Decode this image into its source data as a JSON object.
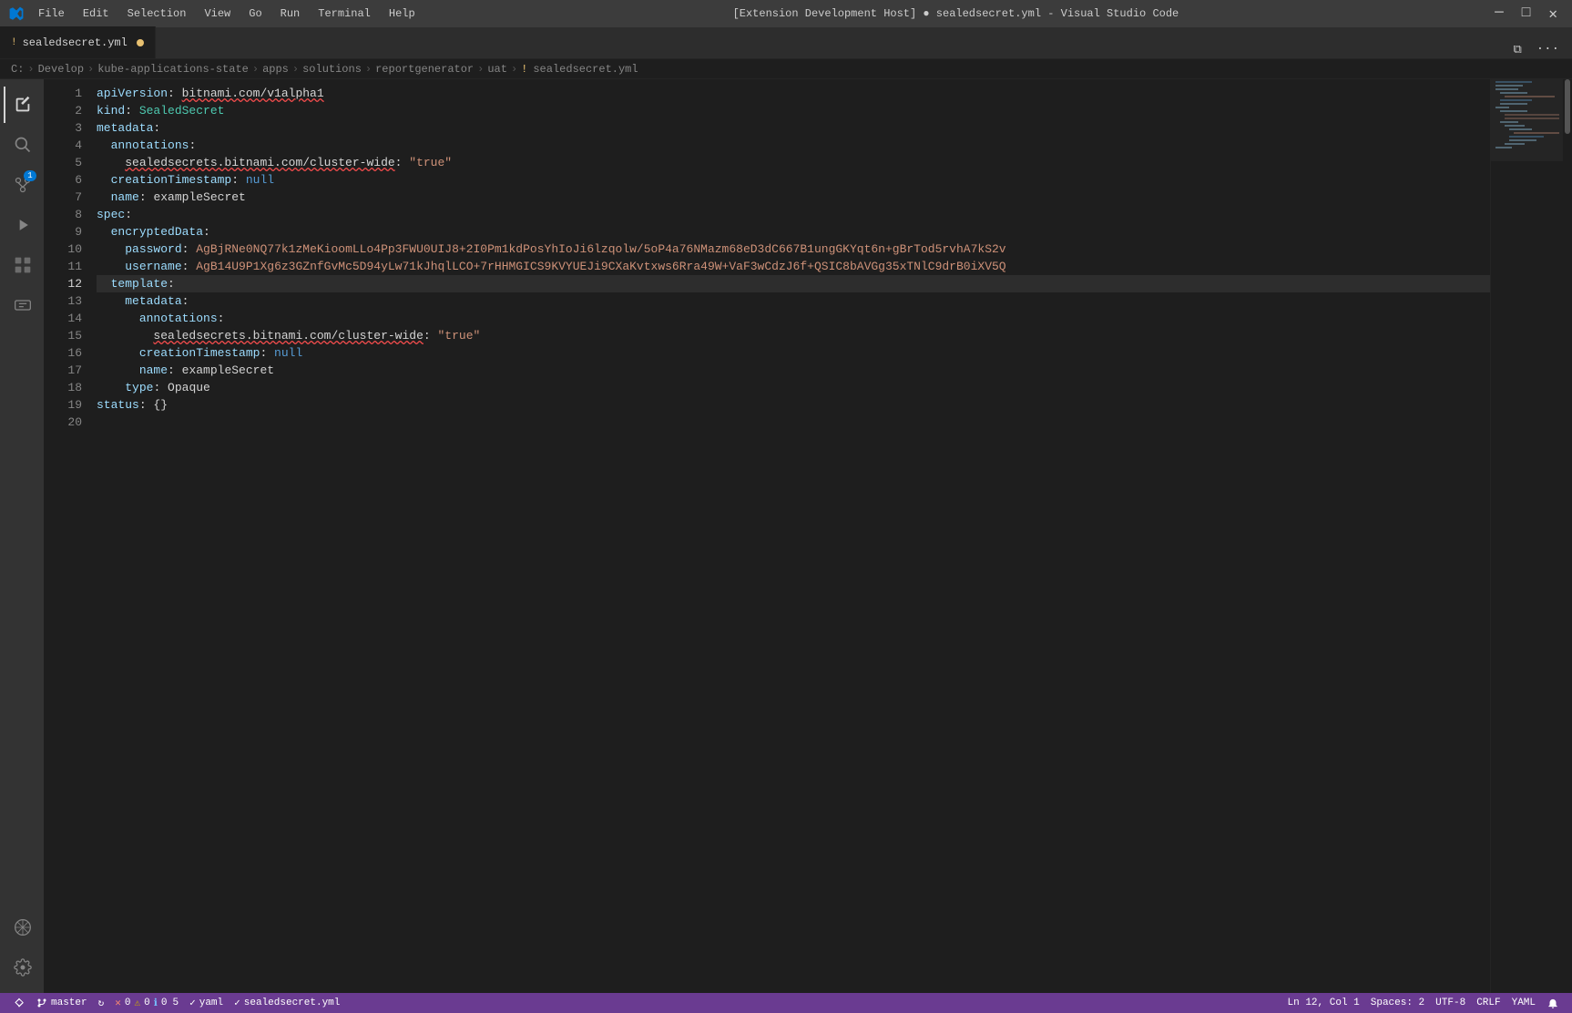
{
  "titleBar": {
    "logo": "vscode-logo",
    "menus": [
      "File",
      "Edit",
      "Selection",
      "View",
      "Go",
      "Run",
      "Terminal",
      "Help"
    ],
    "title": "[Extension Development Host] ● sealedsecret.yml - Visual Studio Code",
    "controls": [
      "─",
      "□",
      "✕"
    ]
  },
  "tab": {
    "icon": "!",
    "filename": "sealedsecret.yml",
    "modified": true
  },
  "breadcrumb": {
    "parts": [
      "C:",
      "Develop",
      "kube-applications-state",
      "apps",
      "solutions",
      "reportgenerator",
      "uat",
      "sealedsecret.yml"
    ]
  },
  "lines": [
    {
      "num": 1,
      "content": "apiVersion: bitnami.com/v1alpha1"
    },
    {
      "num": 2,
      "content": "kind: SealedSecret"
    },
    {
      "num": 3,
      "content": "metadata:"
    },
    {
      "num": 4,
      "content": "  annotations:"
    },
    {
      "num": 5,
      "content": "    sealedsecrets.bitnami.com/cluster-wide: \"true\""
    },
    {
      "num": 6,
      "content": "  creationTimestamp: null"
    },
    {
      "num": 7,
      "content": "  name: exampleSecret"
    },
    {
      "num": 8,
      "content": "spec:"
    },
    {
      "num": 9,
      "content": "  encryptedData:"
    },
    {
      "num": 10,
      "content": "    password: AgBjRNe0NQ77k1zMeKioomLLo4Pp3FWU0UIJ8+2I0Pm1kdPosYhIoJi6lzqolw/5oP4a76NMazm68eD3dC667B1ungGKYqt6n+gBrTod5rvhA7kS2v"
    },
    {
      "num": 11,
      "content": "    username: AgB14U9P1Xg6z3GZnfGvMc5D94yLw71kJhqlLCO+7rHHMGICS9KVYUEJi9CXaKvtxws6Rra49W+VaF3wCdzJ6f+QSIC8bAVGg35xTNlC9drB0iXV5Q"
    },
    {
      "num": 12,
      "content": "  template:"
    },
    {
      "num": 13,
      "content": "    metadata:"
    },
    {
      "num": 14,
      "content": "      annotations:"
    },
    {
      "num": 15,
      "content": "        sealedsecrets.bitnami.com/cluster-wide: \"true\""
    },
    {
      "num": 16,
      "content": "      creationTimestamp: null"
    },
    {
      "num": 17,
      "content": "      name: exampleSecret"
    },
    {
      "num": 18,
      "content": "    type: Opaque"
    },
    {
      "num": 19,
      "content": "status: {}"
    },
    {
      "num": 20,
      "content": ""
    }
  ],
  "statusBar": {
    "branch": "master",
    "sync": "↻",
    "errors": "0",
    "warnings": "0",
    "info": "0",
    "hints": "5",
    "yaml": "yaml",
    "schema": "sealedsecret.yml",
    "position": "Ln 12, Col 1",
    "spaces": "Spaces: 2",
    "encoding": "UTF-8",
    "lineEnding": "CRLF",
    "language": "YAML",
    "notifications": "🔔",
    "remote": ""
  }
}
